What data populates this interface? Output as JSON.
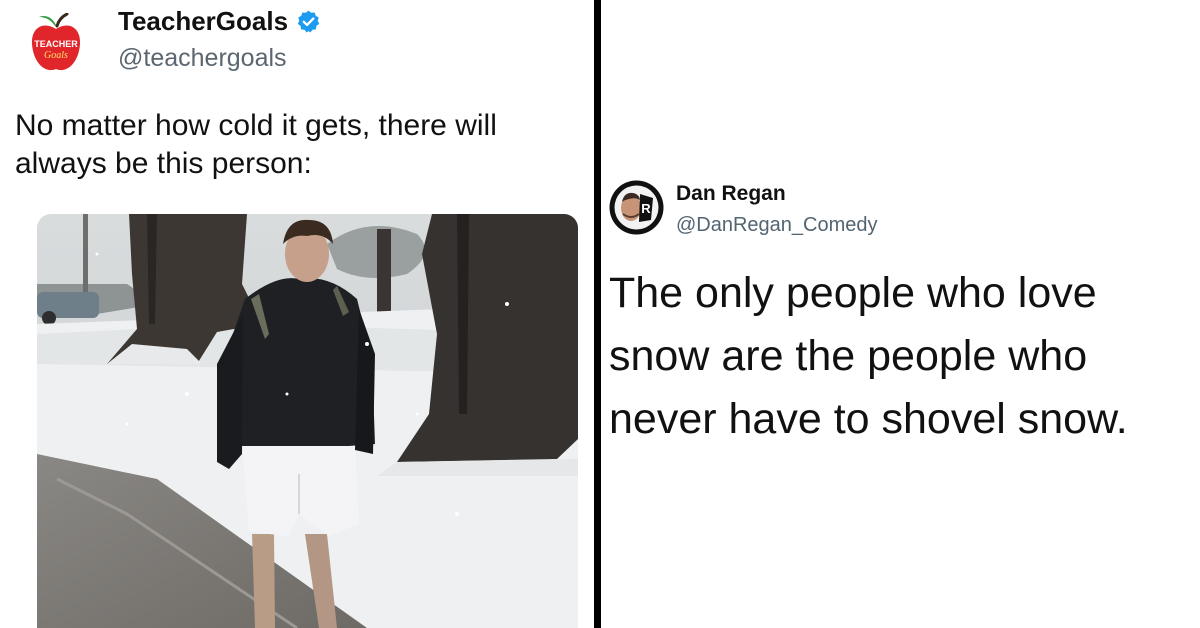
{
  "left_tweet": {
    "author_name": "TeacherGoals",
    "handle": "@teachergoals",
    "avatar_logo_text": [
      "TEACHER",
      "Goals"
    ],
    "text": "No matter how cold it gets, there will always be this person:",
    "verified": true,
    "photo": "man in shorts and fleece walking on snowy path"
  },
  "right_tweet": {
    "author_name": "Dan Regan",
    "handle": "@DanRegan_Comedy",
    "text": "The only people who love snow are the people who never have to shovel snow."
  },
  "colors": {
    "verified_blue": "#1d9bf0",
    "apple_red": "#e0262b",
    "divider": "#000000"
  },
  "icons": [
    "apple-logo-icon",
    "verified-badge-icon",
    "profile-avatar"
  ]
}
